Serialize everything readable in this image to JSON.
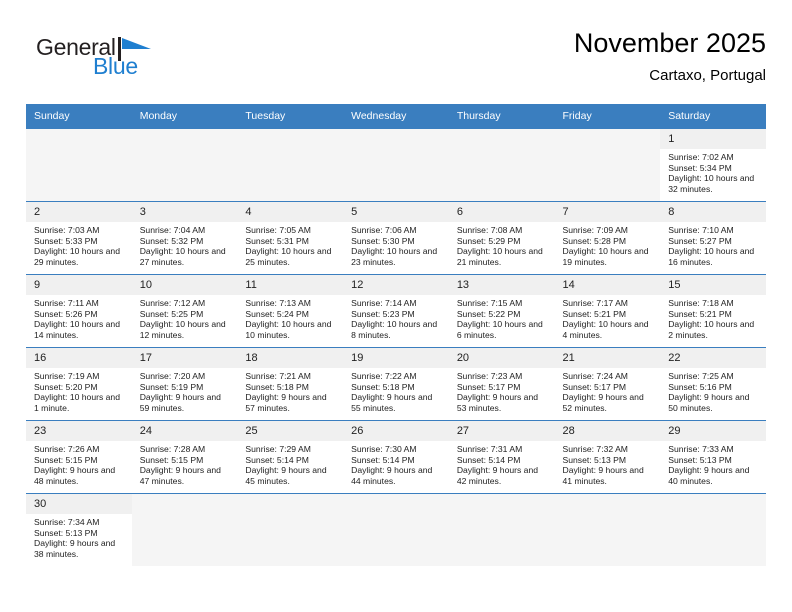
{
  "brand": {
    "name_part1": "General",
    "name_part2": "Blue",
    "accent_color": "#1f7fd0",
    "dark_color": "#231f20"
  },
  "header": {
    "title": "November 2025",
    "subtitle": "Cartaxo, Portugal"
  },
  "theme": {
    "header_bg": "#3a7ebf",
    "header_text": "#ffffff",
    "daynum_bg": "#f0f0f0",
    "grid_line": "#3a7ebf"
  },
  "weekdays": [
    "Sunday",
    "Monday",
    "Tuesday",
    "Wednesday",
    "Thursday",
    "Friday",
    "Saturday"
  ],
  "labels": {
    "sunrise": "Sunrise:",
    "sunset": "Sunset:",
    "daylight": "Daylight:"
  },
  "weeks": [
    [
      {
        "day": "",
        "empty": true
      },
      {
        "day": "",
        "empty": true
      },
      {
        "day": "",
        "empty": true
      },
      {
        "day": "",
        "empty": true
      },
      {
        "day": "",
        "empty": true
      },
      {
        "day": "",
        "empty": true
      },
      {
        "day": "1",
        "sunrise": "Sunrise: 7:02 AM",
        "sunset": "Sunset: 5:34 PM",
        "daylight": "Daylight: 10 hours and 32 minutes."
      }
    ],
    [
      {
        "day": "2",
        "sunrise": "Sunrise: 7:03 AM",
        "sunset": "Sunset: 5:33 PM",
        "daylight": "Daylight: 10 hours and 29 minutes."
      },
      {
        "day": "3",
        "sunrise": "Sunrise: 7:04 AM",
        "sunset": "Sunset: 5:32 PM",
        "daylight": "Daylight: 10 hours and 27 minutes."
      },
      {
        "day": "4",
        "sunrise": "Sunrise: 7:05 AM",
        "sunset": "Sunset: 5:31 PM",
        "daylight": "Daylight: 10 hours and 25 minutes."
      },
      {
        "day": "5",
        "sunrise": "Sunrise: 7:06 AM",
        "sunset": "Sunset: 5:30 PM",
        "daylight": "Daylight: 10 hours and 23 minutes."
      },
      {
        "day": "6",
        "sunrise": "Sunrise: 7:08 AM",
        "sunset": "Sunset: 5:29 PM",
        "daylight": "Daylight: 10 hours and 21 minutes."
      },
      {
        "day": "7",
        "sunrise": "Sunrise: 7:09 AM",
        "sunset": "Sunset: 5:28 PM",
        "daylight": "Daylight: 10 hours and 19 minutes."
      },
      {
        "day": "8",
        "sunrise": "Sunrise: 7:10 AM",
        "sunset": "Sunset: 5:27 PM",
        "daylight": "Daylight: 10 hours and 16 minutes."
      }
    ],
    [
      {
        "day": "9",
        "sunrise": "Sunrise: 7:11 AM",
        "sunset": "Sunset: 5:26 PM",
        "daylight": "Daylight: 10 hours and 14 minutes."
      },
      {
        "day": "10",
        "sunrise": "Sunrise: 7:12 AM",
        "sunset": "Sunset: 5:25 PM",
        "daylight": "Daylight: 10 hours and 12 minutes."
      },
      {
        "day": "11",
        "sunrise": "Sunrise: 7:13 AM",
        "sunset": "Sunset: 5:24 PM",
        "daylight": "Daylight: 10 hours and 10 minutes."
      },
      {
        "day": "12",
        "sunrise": "Sunrise: 7:14 AM",
        "sunset": "Sunset: 5:23 PM",
        "daylight": "Daylight: 10 hours and 8 minutes."
      },
      {
        "day": "13",
        "sunrise": "Sunrise: 7:15 AM",
        "sunset": "Sunset: 5:22 PM",
        "daylight": "Daylight: 10 hours and 6 minutes."
      },
      {
        "day": "14",
        "sunrise": "Sunrise: 7:17 AM",
        "sunset": "Sunset: 5:21 PM",
        "daylight": "Daylight: 10 hours and 4 minutes."
      },
      {
        "day": "15",
        "sunrise": "Sunrise: 7:18 AM",
        "sunset": "Sunset: 5:21 PM",
        "daylight": "Daylight: 10 hours and 2 minutes."
      }
    ],
    [
      {
        "day": "16",
        "sunrise": "Sunrise: 7:19 AM",
        "sunset": "Sunset: 5:20 PM",
        "daylight": "Daylight: 10 hours and 1 minute."
      },
      {
        "day": "17",
        "sunrise": "Sunrise: 7:20 AM",
        "sunset": "Sunset: 5:19 PM",
        "daylight": "Daylight: 9 hours and 59 minutes."
      },
      {
        "day": "18",
        "sunrise": "Sunrise: 7:21 AM",
        "sunset": "Sunset: 5:18 PM",
        "daylight": "Daylight: 9 hours and 57 minutes."
      },
      {
        "day": "19",
        "sunrise": "Sunrise: 7:22 AM",
        "sunset": "Sunset: 5:18 PM",
        "daylight": "Daylight: 9 hours and 55 minutes."
      },
      {
        "day": "20",
        "sunrise": "Sunrise: 7:23 AM",
        "sunset": "Sunset: 5:17 PM",
        "daylight": "Daylight: 9 hours and 53 minutes."
      },
      {
        "day": "21",
        "sunrise": "Sunrise: 7:24 AM",
        "sunset": "Sunset: 5:17 PM",
        "daylight": "Daylight: 9 hours and 52 minutes."
      },
      {
        "day": "22",
        "sunrise": "Sunrise: 7:25 AM",
        "sunset": "Sunset: 5:16 PM",
        "daylight": "Daylight: 9 hours and 50 minutes."
      }
    ],
    [
      {
        "day": "23",
        "sunrise": "Sunrise: 7:26 AM",
        "sunset": "Sunset: 5:15 PM",
        "daylight": "Daylight: 9 hours and 48 minutes."
      },
      {
        "day": "24",
        "sunrise": "Sunrise: 7:28 AM",
        "sunset": "Sunset: 5:15 PM",
        "daylight": "Daylight: 9 hours and 47 minutes."
      },
      {
        "day": "25",
        "sunrise": "Sunrise: 7:29 AM",
        "sunset": "Sunset: 5:14 PM",
        "daylight": "Daylight: 9 hours and 45 minutes."
      },
      {
        "day": "26",
        "sunrise": "Sunrise: 7:30 AM",
        "sunset": "Sunset: 5:14 PM",
        "daylight": "Daylight: 9 hours and 44 minutes."
      },
      {
        "day": "27",
        "sunrise": "Sunrise: 7:31 AM",
        "sunset": "Sunset: 5:14 PM",
        "daylight": "Daylight: 9 hours and 42 minutes."
      },
      {
        "day": "28",
        "sunrise": "Sunrise: 7:32 AM",
        "sunset": "Sunset: 5:13 PM",
        "daylight": "Daylight: 9 hours and 41 minutes."
      },
      {
        "day": "29",
        "sunrise": "Sunrise: 7:33 AM",
        "sunset": "Sunset: 5:13 PM",
        "daylight": "Daylight: 9 hours and 40 minutes."
      }
    ],
    [
      {
        "day": "30",
        "sunrise": "Sunrise: 7:34 AM",
        "sunset": "Sunset: 5:13 PM",
        "daylight": "Daylight: 9 hours and 38 minutes."
      },
      {
        "day": "",
        "empty": true
      },
      {
        "day": "",
        "empty": true
      },
      {
        "day": "",
        "empty": true
      },
      {
        "day": "",
        "empty": true
      },
      {
        "day": "",
        "empty": true
      },
      {
        "day": "",
        "empty": true
      }
    ]
  ]
}
